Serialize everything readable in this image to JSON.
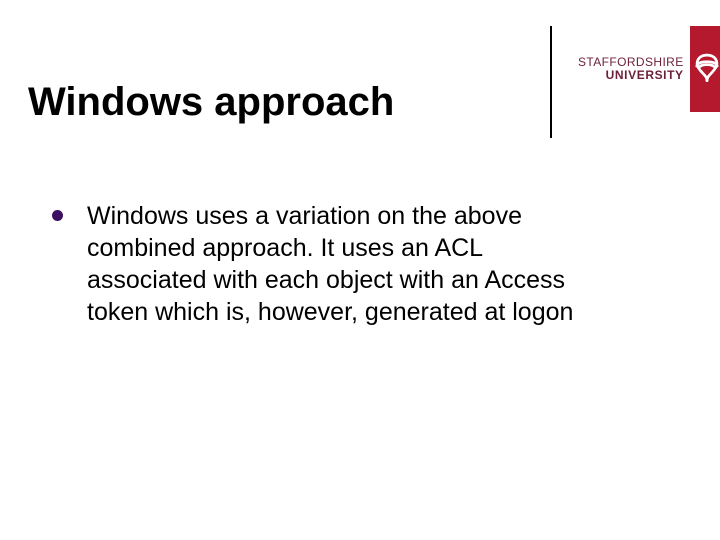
{
  "title": "Windows approach",
  "logo": {
    "line1": "STAFFORDSHIRE",
    "line2": "UNIVERSITY"
  },
  "bullets": [
    "Windows uses a variation on the above combined approach. It uses an ACL associated with each object with an Access token which is, however, generated at logon"
  ],
  "colors": {
    "bullet": "#3e1060",
    "logo_bg": "#b5192d",
    "logo_text": "#6b1f3a"
  }
}
